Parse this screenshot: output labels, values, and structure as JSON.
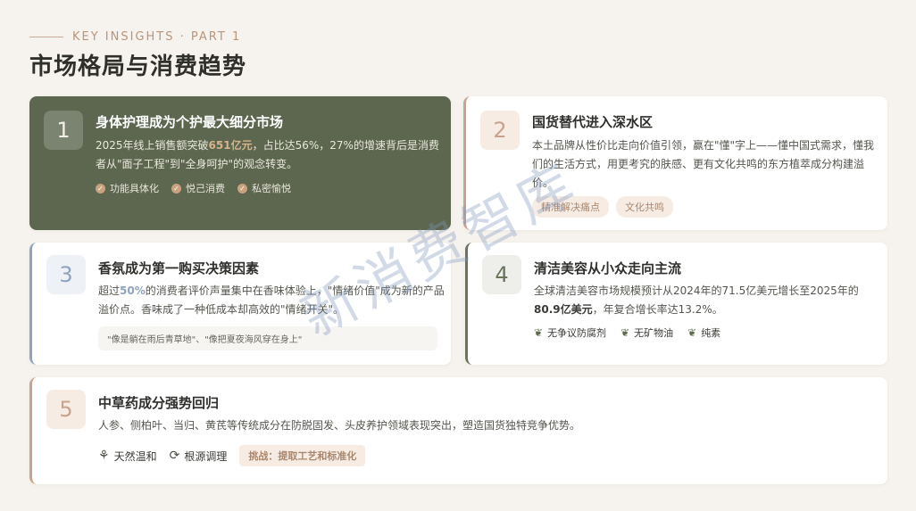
{
  "header": {
    "eyebrow": "KEY INSIGHTS · PART 1",
    "title": "市场格局与消费趋势"
  },
  "cards": [
    {
      "number": "1",
      "title": "身体护理成为个护最大细分市场",
      "body_1": "2025年线上销售额突破",
      "body_hl": "651亿元",
      "body_2": "，占比达56%，27%的增速背后是消费者从\"面子工程\"到\"全身呵护\"的观念转变。",
      "tags": [
        "功能具体化",
        "悦己消费",
        "私密愉悦"
      ]
    },
    {
      "number": "2",
      "title": "国货替代进入深水区",
      "body": "本土品牌从性价比走向价值引领，赢在\"懂\"字上——懂中国式需求，懂我们的生活方式，用更考究的肤感、更有文化共鸣的东方植萃成分构建溢价。",
      "pills": [
        "精准解决痛点",
        "文化共鸣"
      ]
    },
    {
      "number": "3",
      "title": "香氛成为第一购买决策因素",
      "body_1": "超过",
      "body_hl": "50%",
      "body_2": "的消费者评价声量集中在香味体验上，\"情绪价值\"成为新的产品溢价点。香味成了一种低成本却高效的\"情绪开关\"。",
      "quote": "\"像是躺在雨后青草地\"、\"像把夏夜海风穿在身上\""
    },
    {
      "number": "4",
      "title": "清洁美容从小众走向主流",
      "body_1": "全球清洁美容市场规模预计从2024年的71.5亿美元增长至2025年的",
      "body_hl": "80.9亿美元",
      "body_2": "，年复合增长率达13.2%。",
      "tags": [
        "无争议防腐剂",
        "无矿物油",
        "纯素"
      ]
    },
    {
      "number": "5",
      "title": "中草药成分强势回归",
      "body": "人参、侧柏叶、当归、黄芪等传统成分在防脱固发、头皮养护领域表现突出，塑造国货独特竞争优势。",
      "tags": [
        "天然温和",
        "根源调理"
      ],
      "pill": "挑战：提取工艺和标准化"
    }
  ],
  "watermark": "新消费智库",
  "colors": {
    "card1_bg": "#5d6750",
    "accent_tan": "#c7a28c",
    "accent_blue": "#8fa3bf",
    "accent_green": "#6a745c",
    "highlight_gold": "#d6b48a"
  }
}
